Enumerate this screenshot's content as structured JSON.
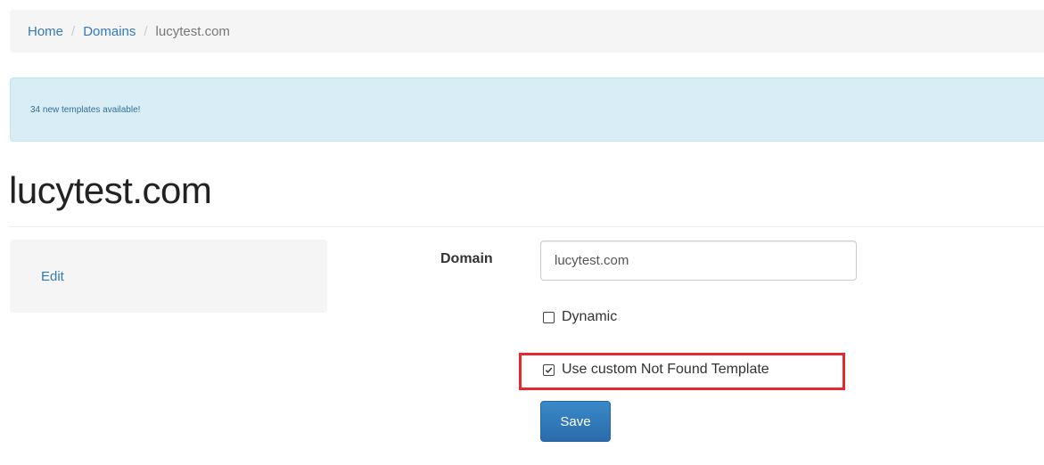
{
  "breadcrumb": {
    "items": [
      {
        "label": "Home"
      },
      {
        "label": "Domains"
      }
    ],
    "separator": "/",
    "current": "lucytest.com"
  },
  "alert": {
    "text": "34 new templates available!"
  },
  "page": {
    "title": "lucytest.com"
  },
  "sidebar": {
    "edit_label": "Edit"
  },
  "form": {
    "domain_label": "Domain",
    "domain_value": "lucytest.com",
    "dynamic_label": "Dynamic",
    "dynamic_checked": false,
    "custom_template_label": "Use custom Not Found Template",
    "custom_template_checked": true,
    "save_label": "Save"
  },
  "colors": {
    "link": "#337ab7",
    "alert_bg": "#d9edf7",
    "highlight": "#e8282e",
    "button": "#2f75b5"
  }
}
